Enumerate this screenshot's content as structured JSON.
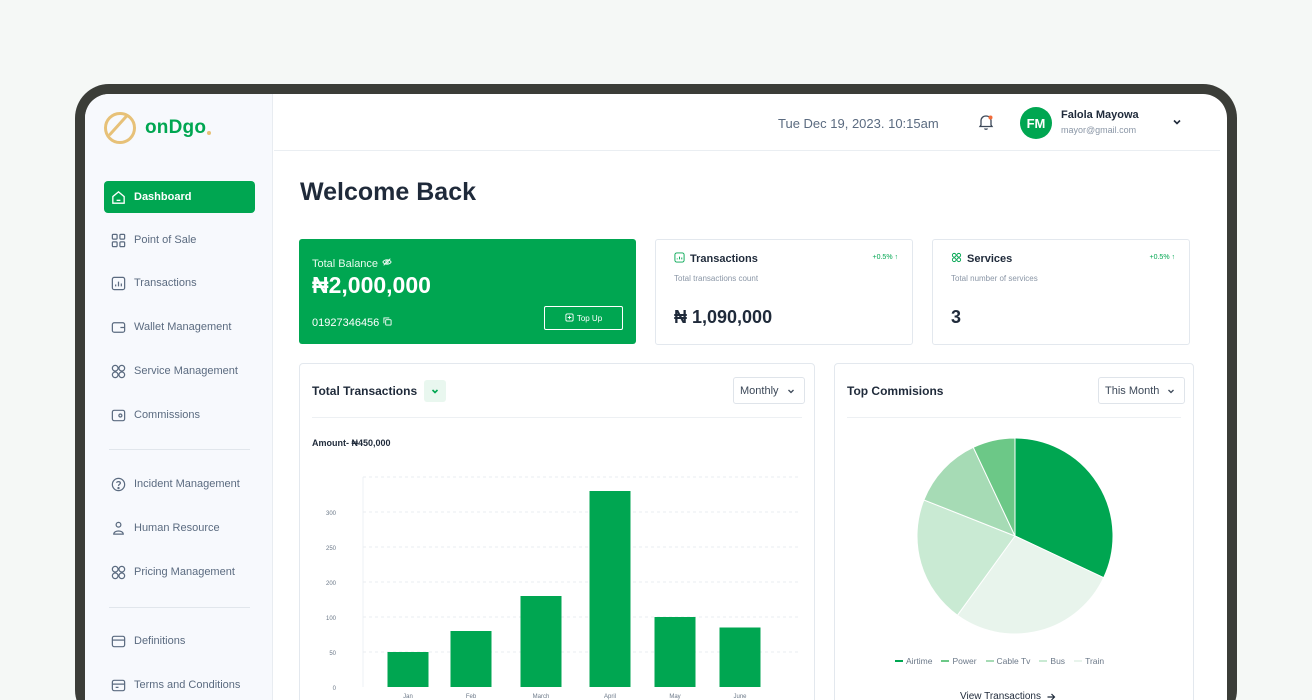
{
  "brand": {
    "name": "onDgo"
  },
  "sidebar": {
    "items": [
      {
        "label": "Dashboard",
        "icon": "home-icon",
        "active": true
      },
      {
        "label": "Point of Sale",
        "icon": "grid-icon"
      },
      {
        "label": "Transactions",
        "icon": "chart-icon"
      },
      {
        "label": "Wallet Management",
        "icon": "wallet-icon"
      },
      {
        "label": "Service Management",
        "icon": "services-icon"
      },
      {
        "label": "Commissions",
        "icon": "commission-icon"
      },
      {
        "label": "Incident Management",
        "icon": "help-icon"
      },
      {
        "label": "Human Resource",
        "icon": "person-icon"
      },
      {
        "label": "Pricing Management",
        "icon": "pricing-icon"
      },
      {
        "label": "Definitions",
        "icon": "definitions-icon"
      },
      {
        "label": "Terms and Conditions",
        "icon": "terms-icon"
      }
    ]
  },
  "header": {
    "datetime": "Tue Dec 19, 2023. 10:15am",
    "user": {
      "initials": "FM",
      "name": "Falola Mayowa",
      "email": "mayor@gmail.com"
    }
  },
  "main": {
    "welcome": "Welcome Back",
    "balance": {
      "label": "Total Balance",
      "amount": "₦2,000,000",
      "account": "01927346456",
      "topup_label": "Top Up"
    },
    "transactions_card": {
      "title": "Transactions",
      "change": "+0.5% ↑",
      "subtitle": "Total transactions count",
      "value": "₦ 1,090,000"
    },
    "services_card": {
      "title": "Services",
      "change": "+0.5% ↑",
      "subtitle": "Total number of services",
      "value": "3"
    },
    "transactions_panel": {
      "title": "Total Transactions",
      "period": "Monthly",
      "amount_label": "Amount- ₦450,000"
    },
    "commissions_panel": {
      "title": "Top Commisions",
      "period": "This Month",
      "view_link": "View Transactions"
    }
  },
  "colors": {
    "accent": "#00a651",
    "accent_text": "#ffffff",
    "logo_gold": "#e7c178"
  },
  "chart_data": [
    {
      "type": "bar",
      "categories": [
        "Jan",
        "Feb",
        "March",
        "April",
        "May",
        "June"
      ],
      "values": [
        50,
        80,
        130,
        280,
        100,
        85
      ],
      "yticks": [
        0,
        50,
        100,
        150,
        200,
        250,
        300
      ],
      "ytick_labels": [
        "0",
        "50",
        "100",
        "200",
        "250",
        "300"
      ],
      "ylim": [
        0,
        300
      ],
      "color": "#00a651",
      "grid": true
    },
    {
      "type": "pie",
      "labels": [
        "Airtime",
        "Power",
        "Cable Tv",
        "Bus",
        "Train"
      ],
      "values": [
        32,
        7,
        12,
        21,
        28
      ],
      "colors": [
        "#00a651",
        "#6cc887",
        "#a6dbb5",
        "#c9ead3",
        "#e8f4ec"
      ],
      "legend": "bottom"
    }
  ]
}
